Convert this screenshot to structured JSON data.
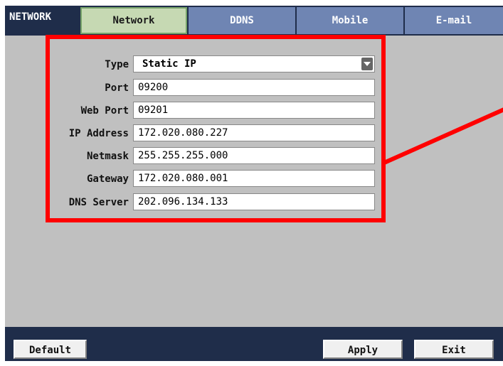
{
  "header": {
    "section_title": "NETWORK",
    "tabs": [
      {
        "label": "Network",
        "active": true
      },
      {
        "label": "DDNS",
        "active": false
      },
      {
        "label": "Mobile",
        "active": false
      },
      {
        "label": "E-mail",
        "active": false
      }
    ]
  },
  "form": {
    "type": {
      "label": "Type",
      "value": "Static IP"
    },
    "port": {
      "label": "Port",
      "value": "09200"
    },
    "web_port": {
      "label": "Web Port",
      "value": "09201"
    },
    "ip_address": {
      "label": "IP Address",
      "value": "172.020.080.227"
    },
    "netmask": {
      "label": "Netmask",
      "value": "255.255.255.000"
    },
    "gateway": {
      "label": "Gateway",
      "value": "172.020.080.001"
    },
    "dns_server": {
      "label": "DNS Server",
      "value": "202.096.134.133"
    }
  },
  "footer": {
    "default_label": "Default",
    "apply_label": "Apply",
    "exit_label": "Exit"
  },
  "colors": {
    "bar_bg": "#1f2d4a",
    "panel_bg": "#c0c0c0",
    "tab_bg": "#6f85b3",
    "active_tab_bg": "#c6d9b3",
    "highlight": "#ff0000"
  }
}
